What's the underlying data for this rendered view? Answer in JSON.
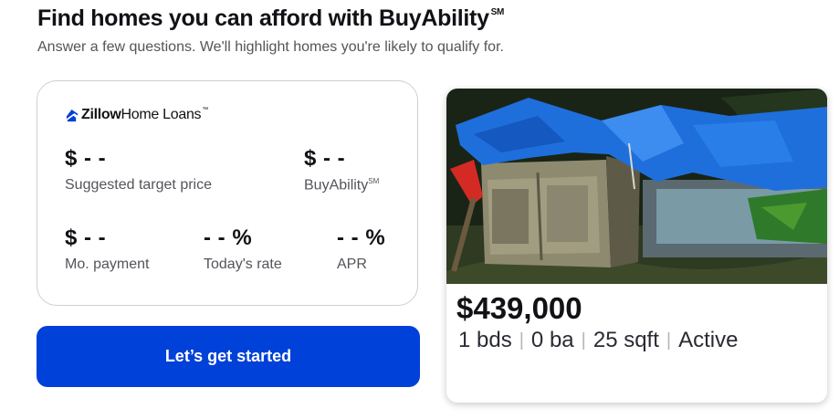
{
  "header": {
    "title": "Find homes you can afford with BuyAbility",
    "title_mark": "SM",
    "subtitle": "Answer a few questions. We'll highlight homes you're likely to qualify for."
  },
  "calculator": {
    "brand_bold": "Zillow",
    "brand_rest": "Home Loans",
    "brand_mark": "™",
    "metrics": [
      {
        "value": "$ - -",
        "label": "Suggested target price"
      },
      {
        "value": "$ - -",
        "label": "BuyAbility",
        "label_mark": "SM"
      },
      {
        "value": "$ - -",
        "label": "Mo. payment"
      },
      {
        "value": "- - %",
        "label": "Today's rate"
      },
      {
        "value": "- - %",
        "label": "APR"
      }
    ]
  },
  "cta": {
    "label": "Let’s get started"
  },
  "listing": {
    "price": "$439,000",
    "beds": "1 bds",
    "baths": "0 ba",
    "sqft": "25 sqft",
    "status": "Active",
    "sep": "|"
  },
  "colors": {
    "accent": "#0041d9",
    "text": "#111116",
    "muted": "#54545a",
    "tarp": "#1e6fdc"
  },
  "icons": {
    "brand": "zillow-z-icon"
  }
}
